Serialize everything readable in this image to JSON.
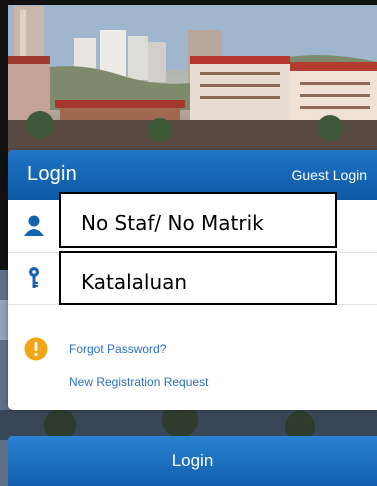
{
  "header": {
    "title": "Login",
    "guest_login": "Guest Login"
  },
  "form": {
    "username_placeholder": "No Staf/ No Matrik",
    "password_placeholder": "Katalaluan"
  },
  "icons": {
    "user": "user-icon",
    "key": "key-icon",
    "warning": "warning-icon"
  },
  "links": {
    "forgot_password": "Forgot Password?",
    "new_registration": "New Registration Request"
  },
  "actions": {
    "login": "Login"
  },
  "colors": {
    "header_blue": "#1565b5",
    "link_blue": "#2b6fc0",
    "warning_orange": "#f2a515"
  }
}
